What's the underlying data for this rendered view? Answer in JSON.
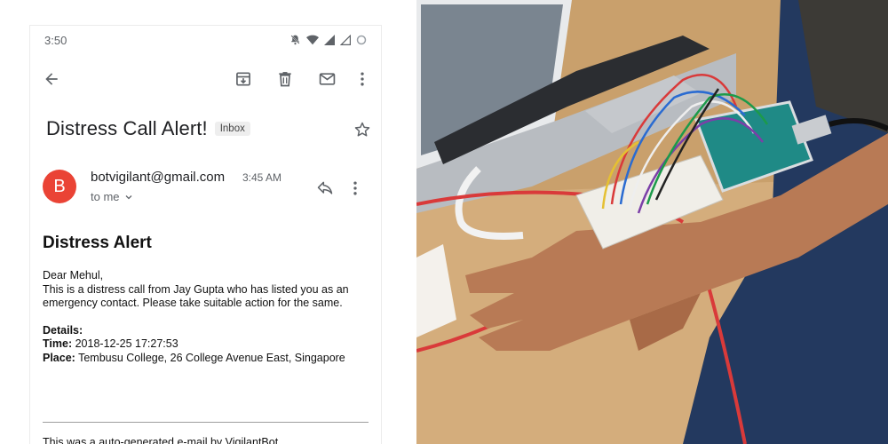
{
  "status_bar": {
    "time": "3:50"
  },
  "toolbar": {
    "back_icon": "arrow-back-icon",
    "archive_icon": "archive-icon",
    "delete_icon": "trash-icon",
    "mark_unread_icon": "envelope-icon",
    "more_icon": "more-vert-icon"
  },
  "email": {
    "subject": "Distress Call Alert!",
    "label": "Inbox",
    "avatar_letter": "B",
    "sender": "botvigilant@gmail.com",
    "time": "3:45 AM",
    "to": "to me",
    "heading": "Distress Alert",
    "greeting": "Dear Mehul,",
    "message_1": "This is a distress call from Jay Gupta who has listed you as an",
    "message_2": "emergency contact. Please take suitable action for the same.",
    "details_label": "Details:",
    "time_label": "Time:",
    "time_value": " 2018-12-25 17:27:53",
    "place_label": "Place:",
    "place_value": " Tembusu College, 26 College Avenue East, Singapore",
    "footer": "This was a auto-generated e-mail by VigilantBot."
  },
  "colors": {
    "avatar": "#ea4335",
    "icon_gray": "#5f6368",
    "arduino_teal": "#1f8a86"
  }
}
